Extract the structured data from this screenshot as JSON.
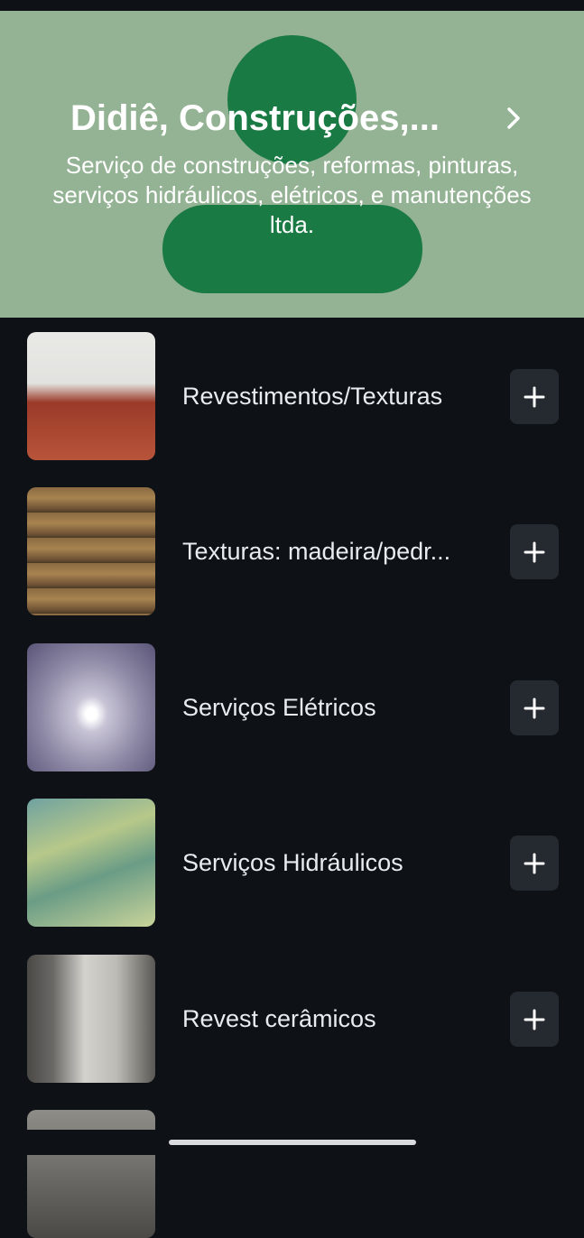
{
  "header": {
    "title": "Didiê, Construções,...",
    "subtitle": "Serviço de construções, reformas, pinturas, serviços hidráulicos, elétricos, e manutenções ltda."
  },
  "items": [
    {
      "label": "Revestimentos/Texturas"
    },
    {
      "label": "Texturas: madeira/pedr..."
    },
    {
      "label": "Serviços Elétricos"
    },
    {
      "label": "Serviços Hidráulicos"
    },
    {
      "label": "Revest cerâmicos"
    }
  ],
  "colors": {
    "header_bg": "#94b294",
    "avatar": "#1a7a44",
    "background": "#0e1217",
    "button_bg": "#252a30"
  }
}
